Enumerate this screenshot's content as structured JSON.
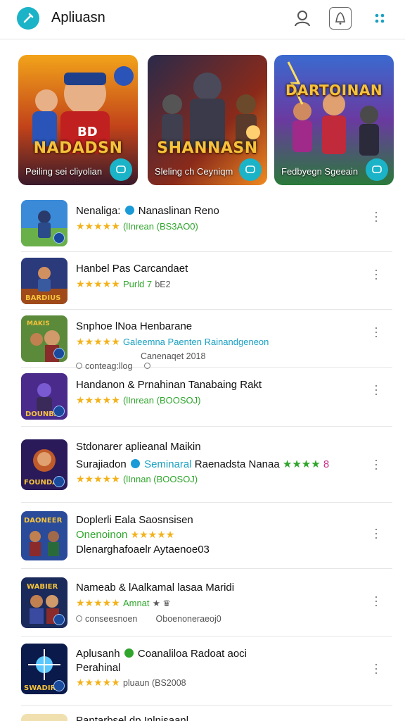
{
  "header": {
    "title": "Apliuasn"
  },
  "featured": [
    {
      "title": "NADADSN",
      "caption": "Peiling sei cliyolian"
    },
    {
      "title": "SHANNASN",
      "caption": "Sleling ch Ceyniqm"
    },
    {
      "title": "DARTOINAN",
      "caption": "Fedbyegn Sgeeain"
    }
  ],
  "list": [
    {
      "title": "Nenaliga:",
      "developer": "Nanaslinan Reno",
      "rating_stars": "★★★★★",
      "meta": "(lInrean (BS3AO0)",
      "verified": true
    },
    {
      "title": "Hanbel Pas Carcandaet",
      "rating_stars": "★★★★★",
      "meta_green": "Purld 7",
      "meta": "bE2"
    },
    {
      "title": "Snphoe lNoa Henbarane",
      "rating_stars": "★★★★★",
      "meta_teal": "Galeemna Paenten Rainandgeneon",
      "sub_right": "Canenaqet 2018",
      "sub_left": "conteag:llog"
    },
    {
      "title": "Handanon & Prnahinan Tanabaing Rakt",
      "rating_stars": "★★★★★",
      "meta": "(lInrean (BOOSOJ)"
    },
    {
      "title": "Stdonarer aplieanal Maikin",
      "line2_left": "Surajiadon",
      "line2_teal": "Seminaral",
      "line2_rest": "Raenadsta Nanaa",
      "line2_stars": "★★★★",
      "line2_tail": "8",
      "rating_stars": "★★★★★",
      "meta": "(lInnan (BOOSOJ)"
    },
    {
      "title": "Doplerli Eala Saosnsisen",
      "line2_green": "Onenoinon",
      "line2_stars": "★★★★★",
      "line3": "Dlenarghafoaelr Aytaenoe03"
    },
    {
      "title": "Nameab & lAalkamal lasaa Maridi",
      "rating_stars": "★★★★★",
      "meta_green": "Amnat",
      "meta": "★ ♛",
      "sub_left": "conseesnoen",
      "sub_right": "Oboenoneraeoj0"
    },
    {
      "title": "Aplusanh",
      "developer": "Coanaliloa Radoat aoci",
      "title2": "Perahinal",
      "rating_stars": "★★★★★",
      "meta": "pluaun (BS2008"
    },
    {
      "title": "Pantarbsel dp Inlnisaanl"
    }
  ],
  "colors": {
    "accent": "#1ab3c7",
    "star": "#f3b21b",
    "green": "#2fa52c",
    "teal": "#1aa0c2"
  }
}
